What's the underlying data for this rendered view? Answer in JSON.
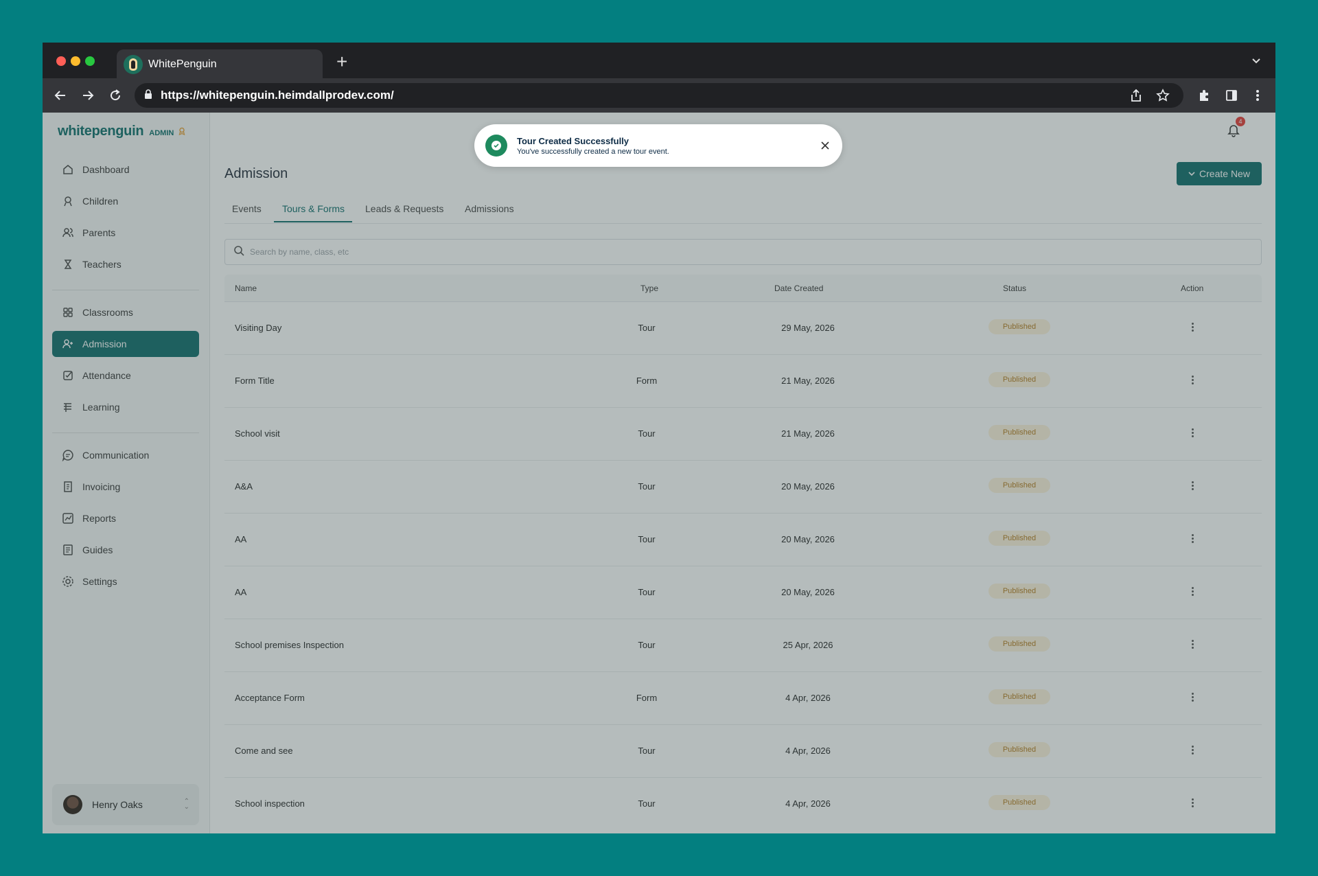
{
  "browser": {
    "tab_title": "WhitePenguin",
    "url": "https://whitepenguin.heimdallprodev.com/"
  },
  "brand": {
    "name": "whitepenguin",
    "tag": "ADMIN"
  },
  "sidebar": {
    "items": [
      {
        "label": "Dashboard",
        "icon": "home-icon"
      },
      {
        "label": "Children",
        "icon": "child-icon"
      },
      {
        "label": "Parents",
        "icon": "users-icon"
      },
      {
        "label": "Teachers",
        "icon": "teacher-icon"
      },
      {
        "label": "Classrooms",
        "icon": "grid-icon"
      },
      {
        "label": "Admission",
        "icon": "user-plus-icon",
        "active": true
      },
      {
        "label": "Attendance",
        "icon": "checkbox-icon"
      },
      {
        "label": "Learning",
        "icon": "book-icon"
      },
      {
        "label": "Communication",
        "icon": "chat-icon"
      },
      {
        "label": "Invoicing",
        "icon": "invoice-icon"
      },
      {
        "label": "Reports",
        "icon": "chart-icon"
      },
      {
        "label": "Guides",
        "icon": "document-icon"
      },
      {
        "label": "Settings",
        "icon": "gear-icon"
      }
    ]
  },
  "user": {
    "name": "Henry Oaks"
  },
  "notifications": {
    "count": "4"
  },
  "toast": {
    "title": "Tour Created Successfully",
    "message": "You've successfully created a new tour event."
  },
  "page": {
    "title": "Admission",
    "create_button": "Create New"
  },
  "tabs": [
    {
      "label": "Events"
    },
    {
      "label": "Tours & Forms",
      "active": true
    },
    {
      "label": "Leads & Requests"
    },
    {
      "label": "Admissions"
    }
  ],
  "search": {
    "placeholder": "Search by name, class, etc"
  },
  "table": {
    "headers": [
      "Name",
      "Type",
      "Date Created",
      "Status",
      "Action"
    ],
    "rows": [
      {
        "name": "Visiting Day",
        "type": "Tour",
        "date": "29 May, 2026",
        "status": "Published"
      },
      {
        "name": "Form Title",
        "type": "Form",
        "date": "21 May, 2026",
        "status": "Published"
      },
      {
        "name": "School visit",
        "type": "Tour",
        "date": "21 May, 2026",
        "status": "Published"
      },
      {
        "name": "A&A",
        "type": "Tour",
        "date": "20 May, 2026",
        "status": "Published"
      },
      {
        "name": "AA",
        "type": "Tour",
        "date": "20 May, 2026",
        "status": "Published"
      },
      {
        "name": "AA",
        "type": "Tour",
        "date": "20 May, 2026",
        "status": "Published"
      },
      {
        "name": "School premises Inspection",
        "type": "Tour",
        "date": "25 Apr, 2026",
        "status": "Published"
      },
      {
        "name": "Acceptance Form",
        "type": "Form",
        "date": "4 Apr, 2026",
        "status": "Published"
      },
      {
        "name": "Come and see",
        "type": "Tour",
        "date": "4 Apr, 2026",
        "status": "Published"
      },
      {
        "name": "School inspection",
        "type": "Tour",
        "date": "4 Apr, 2026",
        "status": "Published"
      }
    ]
  },
  "colors": {
    "background": "#037f80",
    "primary": "#0c6b6a",
    "status_badge_bg": "#fdf2dc",
    "status_badge_text": "#b27a1d",
    "toast_success": "#1e8a5e"
  }
}
